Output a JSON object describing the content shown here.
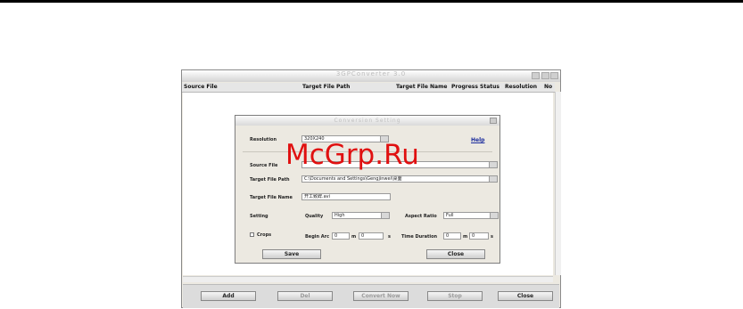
{
  "app": {
    "title": "3GPConverter 3.0",
    "columns": [
      "Source File",
      "Target File Path",
      "Target File Name",
      "Progress",
      "Status",
      "Resolution",
      "No"
    ],
    "buttons": {
      "add": "Add",
      "del": "Del",
      "convert": "Convert Now",
      "stop": "Stop",
      "close": "Close"
    }
  },
  "dialog": {
    "title": "Conversion Setting",
    "help": "Help",
    "resolution_label": "Resolution",
    "resolution_value": "320X240",
    "source_label": "Source File",
    "source_value": "",
    "target_path_label": "Target File Path",
    "target_path_value": "C:\\Documents and Settings\\Gengjinwei\\桌面",
    "target_name_label": "Target File Name",
    "target_name_value": "开工致辞.avi",
    "setting_label": "Setting",
    "quality_label": "Quality",
    "quality_value": "High",
    "aspect_label": "Aspect Ratio",
    "aspect_value": "Full",
    "crops_label": "Crops",
    "begin_label": "Begin Arc",
    "time_label": "Time Duration",
    "m_unit": "m",
    "s_unit": "s",
    "begin_m": "0",
    "begin_s": "0",
    "dur_m": "0",
    "dur_s": "0",
    "save": "Save",
    "close": "Close"
  },
  "watermark": "McGrp.Ru"
}
